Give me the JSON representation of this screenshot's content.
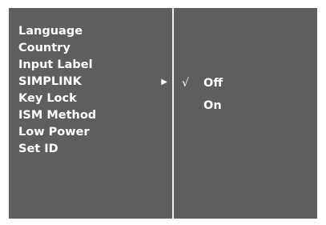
{
  "menu": {
    "items": [
      {
        "label": "Language"
      },
      {
        "label": "Country"
      },
      {
        "label": "Input Label"
      },
      {
        "label": "SIMPLINK",
        "selected": true
      },
      {
        "label": "Key Lock"
      },
      {
        "label": "ISM Method"
      },
      {
        "label": "Low Power"
      },
      {
        "label": "Set ID"
      }
    ],
    "submenu_arrow": "▶"
  },
  "submenu": {
    "check_mark": "√",
    "options": [
      {
        "label": "Off",
        "checked": true
      },
      {
        "label": "On",
        "checked": false
      }
    ]
  },
  "colors": {
    "panel_background": "#5e5e5e",
    "divider": "#f2f2f2",
    "text": "#ffffff"
  },
  "icons": {
    "submenu_arrow": "triangle-right-icon",
    "check_mark": "checkmark-icon"
  }
}
